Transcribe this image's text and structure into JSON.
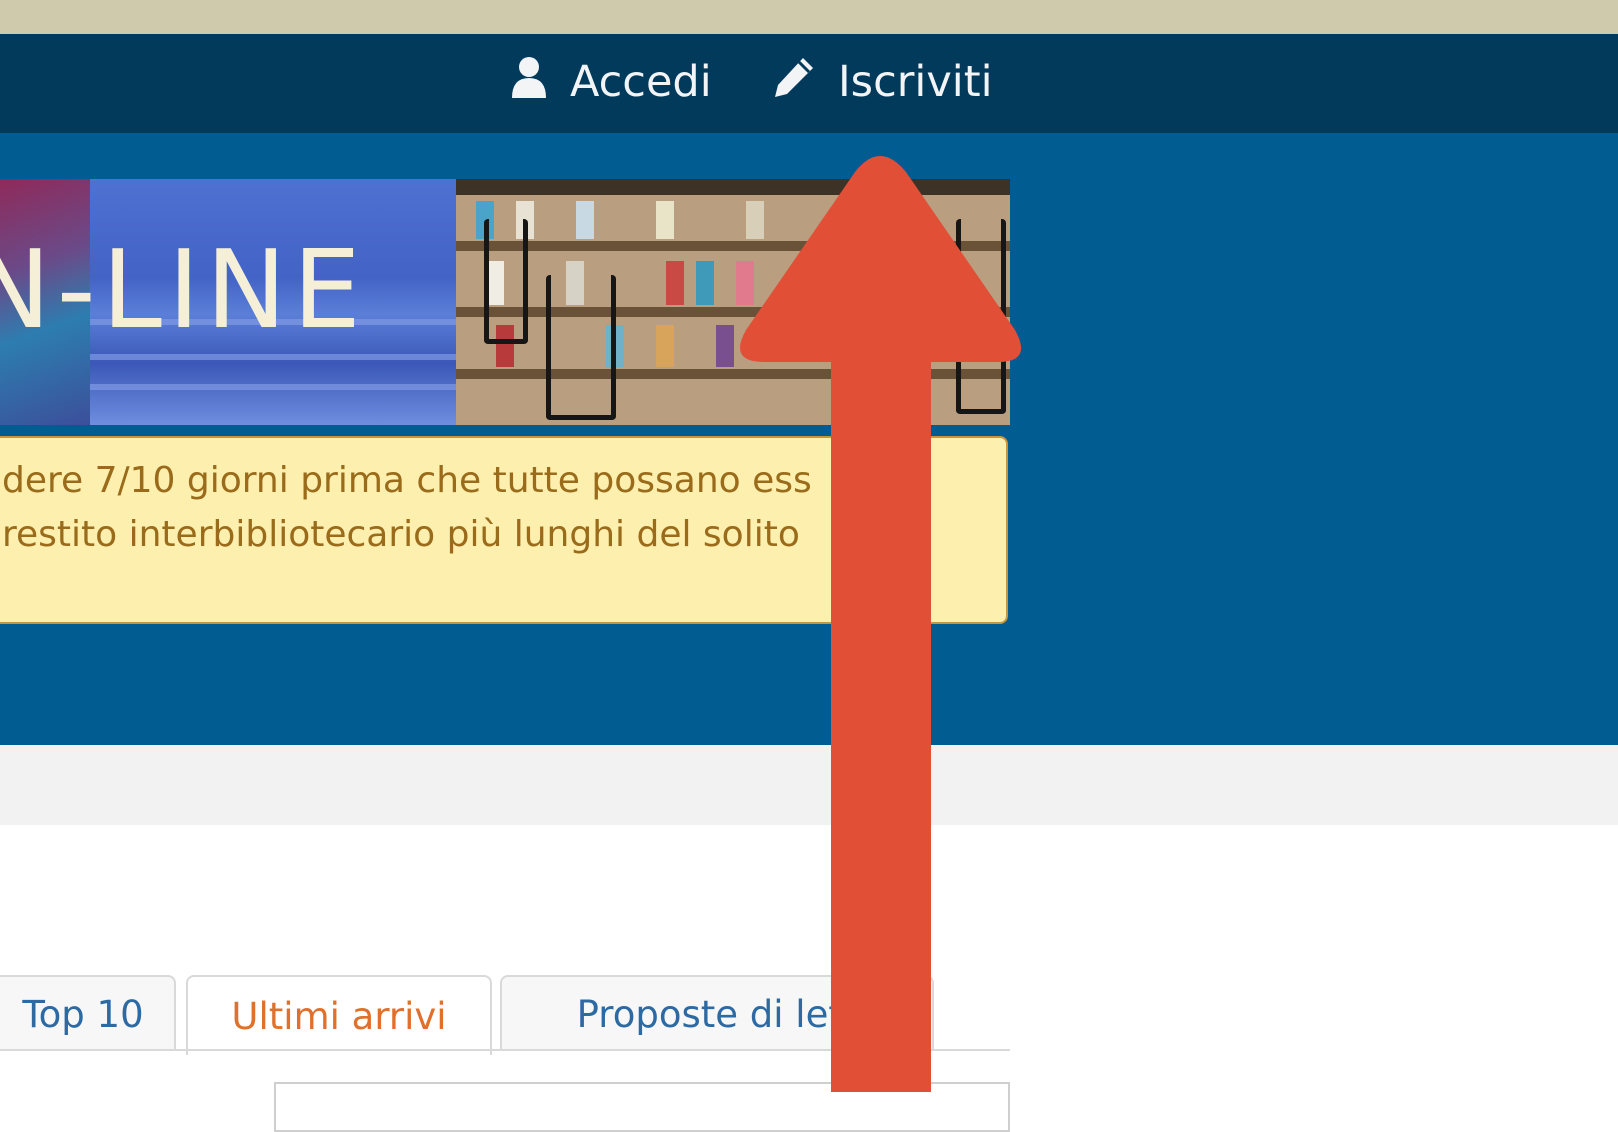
{
  "navbar": {
    "login": {
      "label": "Accedi",
      "icon": "user-icon"
    },
    "signup": {
      "label": "Iscriviti",
      "icon": "pencil-icon"
    }
  },
  "banner": {
    "text": "N-LINE"
  },
  "alert": {
    "line1": "dere 7/10 giorni prima che tutte possano ess",
    "line2": "restito interbibliotecario più lunghi del solito"
  },
  "tabs": [
    {
      "label": "Top 10",
      "active": false
    },
    {
      "label": "Ultimi arrivi",
      "active": true
    },
    {
      "label": "Proposte di lett",
      "active": false
    }
  ],
  "colors": {
    "top_strip": "#cfcaab",
    "navbar": "#023a5c",
    "hero": "#015c92",
    "alert_bg": "#fdefae",
    "alert_text": "#9a6b1a",
    "tab_active_text": "#e0712c",
    "tab_text": "#2d6aa3",
    "annotation_arrow": "#e14f37"
  },
  "annotation": {
    "icon": "up-arrow-icon"
  }
}
